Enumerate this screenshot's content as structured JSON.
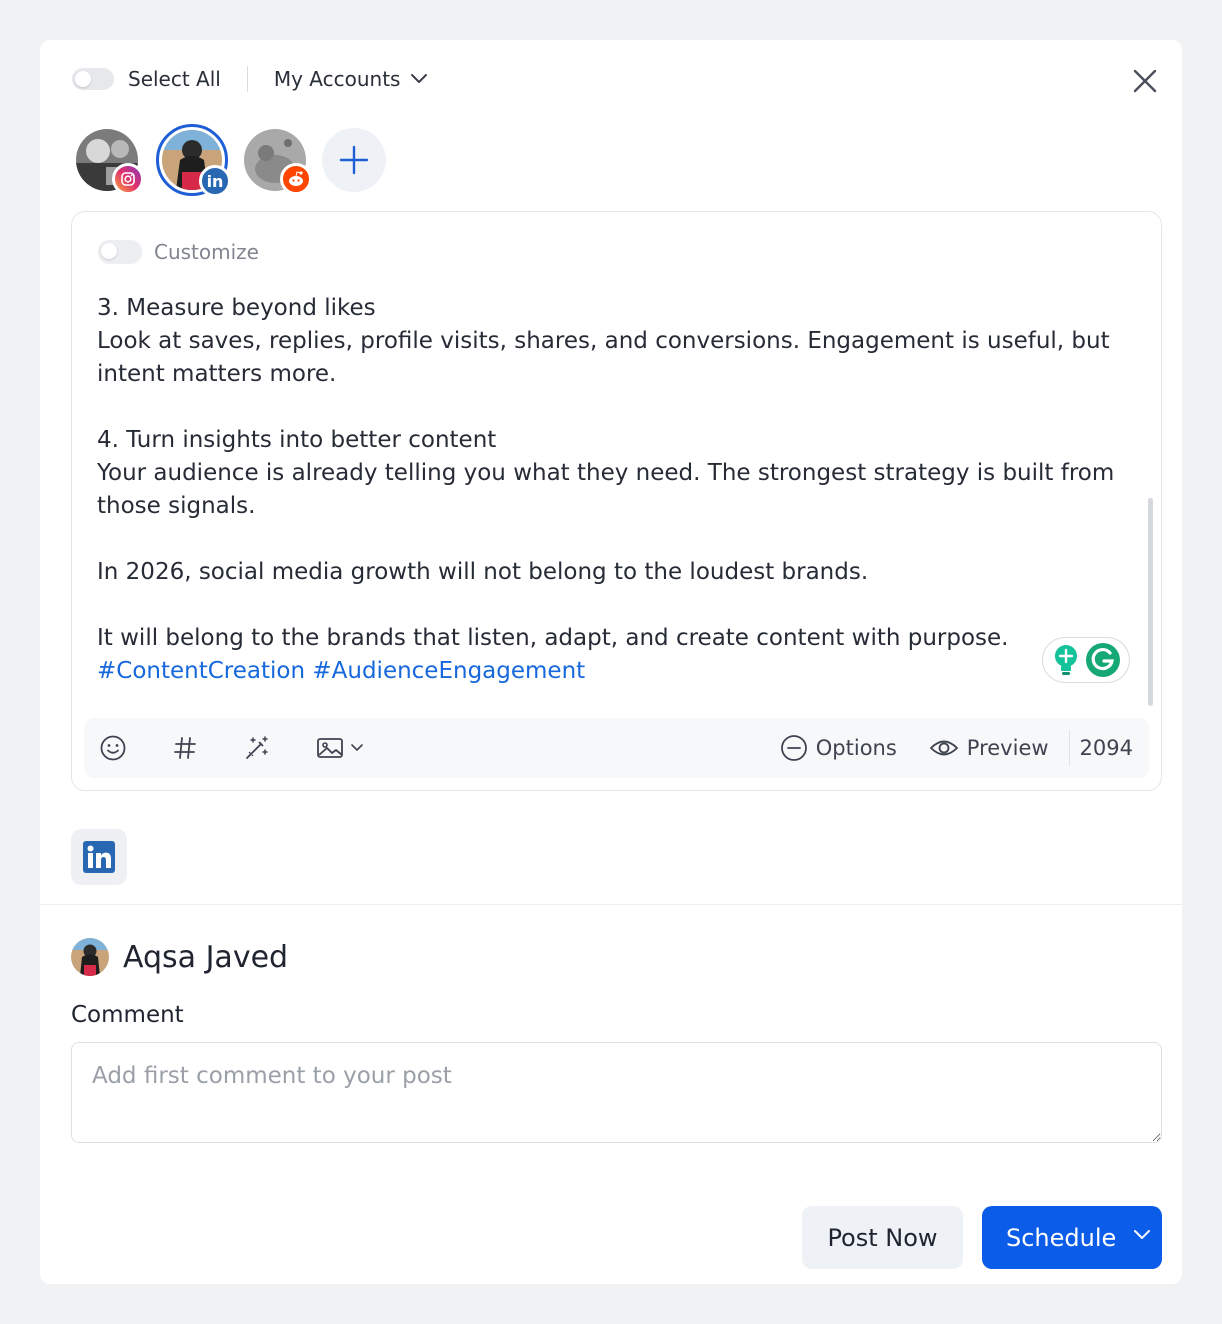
{
  "header": {
    "select_all_label": "Select All",
    "accounts_label": "My Accounts"
  },
  "accounts": [
    {
      "platform": "instagram",
      "selected": false,
      "badge_color": "#e1306c"
    },
    {
      "platform": "linkedin",
      "selected": true,
      "badge_color": "#2867b2"
    },
    {
      "platform": "reddit",
      "selected": false,
      "badge_color": "#ff4500"
    }
  ],
  "editor": {
    "customize_label": "Customize",
    "text": "3. Measure beyond likes\nLook at saves, replies, profile visits, shares, and conversions. Engagement is useful, but intent matters more.\n\n4. Turn insights into better content\nYour audience is already telling you what they need. The strongest strategy is built from those signals.\n\nIn 2026, social media growth will not belong to the loudest brands.\n\nIt will belong to the brands that listen, adapt, and create content with purpose.",
    "hashtags": "#ContentCreation #AudienceEngagement",
    "toolbar": {
      "options_label": "Options",
      "preview_label": "Preview",
      "char_count": "2094"
    }
  },
  "preview_tab": {
    "platform": "linkedin"
  },
  "author": {
    "name": "Aqsa Javed"
  },
  "comment": {
    "label": "Comment",
    "placeholder": "Add first comment to your post",
    "value": ""
  },
  "actions": {
    "post_now_label": "Post Now",
    "schedule_label": "Schedule"
  },
  "colors": {
    "accent": "#0b5ce8",
    "hashtag": "#1668dc",
    "linkedin": "#2867b2",
    "grammarly": "#15c39a"
  }
}
